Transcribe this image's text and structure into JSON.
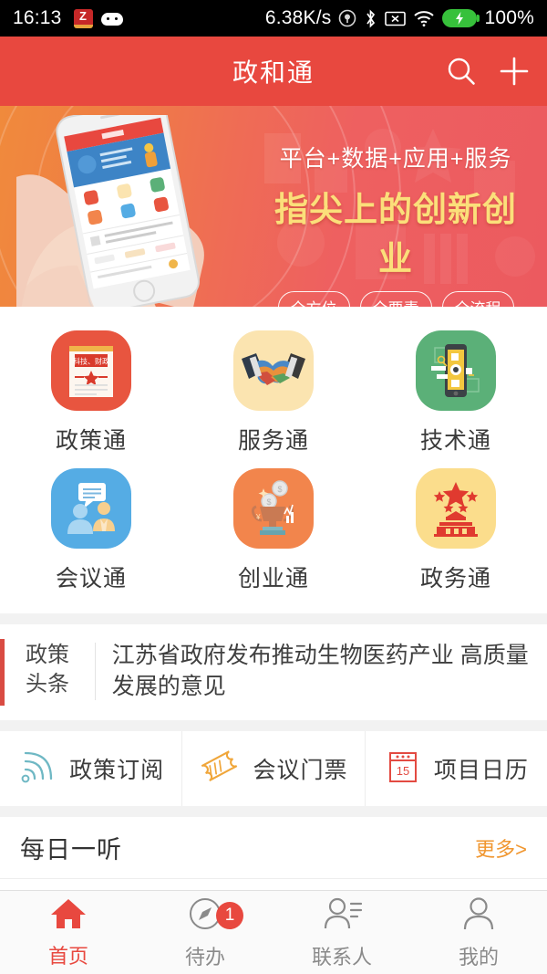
{
  "status_bar": {
    "time": "16:13",
    "app_icon_letter": "Z",
    "network_speed": "6.38K/s",
    "battery_percent": "100%",
    "icons": [
      "z-app-icon",
      "robot-icon",
      "headset-icon",
      "bluetooth-icon",
      "no-sim-icon",
      "wifi-icon",
      "battery-charging-icon"
    ]
  },
  "header": {
    "title": "政和通",
    "search_icon": "search-icon",
    "add_icon": "plus-icon"
  },
  "banner": {
    "subtitle": "平台+数据+应用+服务",
    "headline": "指尖上的创新创业",
    "pills": [
      "全方位",
      "全要素",
      "全流程"
    ],
    "headline_color": "#fbdf7a",
    "bg_start": "#f08a3c",
    "bg_end": "#ec5a5f"
  },
  "grid": {
    "items": [
      {
        "label": "政策通",
        "icon": "document-policy-icon",
        "doc_text": "科技、财政",
        "bg": "#e8553f"
      },
      {
        "label": "服务通",
        "icon": "handshake-icon",
        "bg": "#fbe4b0"
      },
      {
        "label": "技术通",
        "icon": "smartphone-tech-icon",
        "bg": "#5bb078"
      },
      {
        "label": "会议通",
        "icon": "meeting-people-icon",
        "bg": "#55ace4"
      },
      {
        "label": "创业通",
        "icon": "trophy-coins-icon",
        "bg": "#f2854c"
      },
      {
        "label": "政务通",
        "icon": "tiananmen-stars-icon",
        "bg": "#fbdd8c"
      }
    ]
  },
  "news": {
    "tag_line1": "政策",
    "tag_line2": "头条",
    "headline": "江苏省政府发布推动生物医药产业 高质量发展的意见",
    "accent_color": "#d94b42"
  },
  "quick_actions": {
    "items": [
      {
        "label": "政策订阅",
        "icon": "rss-signal-icon",
        "color": "#6fb8c4"
      },
      {
        "label": "会议门票",
        "icon": "ticket-icon",
        "color": "#f0a63a"
      },
      {
        "label": "项目日历",
        "icon": "calendar-icon",
        "color": "#e34a41",
        "calendar_day": "15"
      }
    ]
  },
  "daily": {
    "title": "每日一听",
    "more_label": "更多>",
    "more_color": "#f0962f"
  },
  "tabbar": {
    "items": [
      {
        "label": "首页",
        "icon": "home-icon",
        "active": true,
        "badge": ""
      },
      {
        "label": "待办",
        "icon": "compass-icon",
        "active": false,
        "badge": "1"
      },
      {
        "label": "联系人",
        "icon": "contacts-icon",
        "active": false,
        "badge": ""
      },
      {
        "label": "我的",
        "icon": "person-icon",
        "active": false,
        "badge": ""
      }
    ],
    "active_color": "#e8483f"
  }
}
